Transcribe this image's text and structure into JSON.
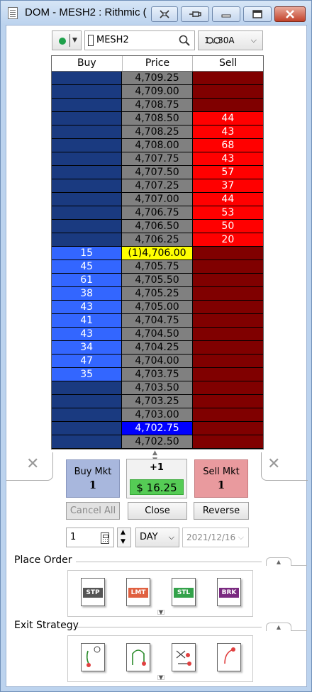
{
  "window": {
    "title": "DOM - MESH2 : Rithmic (",
    "buttons": [
      "restore-group",
      "pin",
      "minimize",
      "maximize",
      "close"
    ]
  },
  "toolbar": {
    "connection_status": "connected",
    "symbol": "MESH2",
    "account": "1...30A"
  },
  "ladder": {
    "headers": {
      "buy": "Buy",
      "price": "Price",
      "sell": "Sell"
    },
    "rows": [
      {
        "buy": "",
        "price": "4,709.25",
        "sell": ""
      },
      {
        "buy": "",
        "price": "4,709.00",
        "sell": ""
      },
      {
        "buy": "",
        "price": "4,708.75",
        "sell": ""
      },
      {
        "buy": "",
        "price": "4,708.50",
        "sell": "44"
      },
      {
        "buy": "",
        "price": "4,708.25",
        "sell": "43"
      },
      {
        "buy": "",
        "price": "4,708.00",
        "sell": "68"
      },
      {
        "buy": "",
        "price": "4,707.75",
        "sell": "43"
      },
      {
        "buy": "",
        "price": "4,707.50",
        "sell": "57"
      },
      {
        "buy": "",
        "price": "4,707.25",
        "sell": "37"
      },
      {
        "buy": "",
        "price": "4,707.00",
        "sell": "44"
      },
      {
        "buy": "",
        "price": "4,706.75",
        "sell": "53"
      },
      {
        "buy": "",
        "price": "4,706.50",
        "sell": "50"
      },
      {
        "buy": "",
        "price": "4,706.25",
        "sell": "20"
      },
      {
        "buy": "15",
        "price": "(1)4,706.00",
        "sell": "",
        "highlight": "last"
      },
      {
        "buy": "45",
        "price": "4,705.75",
        "sell": ""
      },
      {
        "buy": "61",
        "price": "4,705.50",
        "sell": ""
      },
      {
        "buy": "38",
        "price": "4,705.25",
        "sell": ""
      },
      {
        "buy": "43",
        "price": "4,705.00",
        "sell": ""
      },
      {
        "buy": "41",
        "price": "4,704.75",
        "sell": ""
      },
      {
        "buy": "43",
        "price": "4,704.50",
        "sell": ""
      },
      {
        "buy": "34",
        "price": "4,704.25",
        "sell": ""
      },
      {
        "buy": "47",
        "price": "4,704.00",
        "sell": ""
      },
      {
        "buy": "35",
        "price": "4,703.75",
        "sell": ""
      },
      {
        "buy": "",
        "price": "4,703.50",
        "sell": ""
      },
      {
        "buy": "",
        "price": "4,703.25",
        "sell": ""
      },
      {
        "buy": "",
        "price": "4,703.00",
        "sell": ""
      },
      {
        "buy": "",
        "price": "4,702.75",
        "sell": "",
        "highlight": "bid"
      },
      {
        "buy": "",
        "price": "4,702.50",
        "sell": ""
      }
    ]
  },
  "order_panel": {
    "buy_mkt_label": "Buy Mkt",
    "buy_mkt_qty": "1",
    "position": "+1",
    "pnl": "$ 16.25",
    "sell_mkt_label": "Sell Mkt",
    "sell_mkt_qty": "1",
    "cancel_all": "Cancel All",
    "close": "Close",
    "reverse": "Reverse",
    "quantity": "1",
    "tif": "DAY",
    "date": "2021/12/16"
  },
  "place_order": {
    "title": "Place Order",
    "items": [
      {
        "tag": "STP",
        "color": "#555555"
      },
      {
        "tag": "LMT",
        "color": "#e06040"
      },
      {
        "tag": "STL",
        "color": "#33a24a"
      },
      {
        "tag": "BRK",
        "color": "#7a2a80"
      }
    ]
  },
  "exit_strategy": {
    "title": "Exit Strategy"
  },
  "colors": {
    "buy_bg": "#1a3a80",
    "buy_filled": "#3366ff",
    "sell_bg": "#800000",
    "sell_filled": "#ff0000",
    "price_bg": "#808080",
    "last_price": "#ffff00",
    "pnl_bg": "#55cc55"
  }
}
